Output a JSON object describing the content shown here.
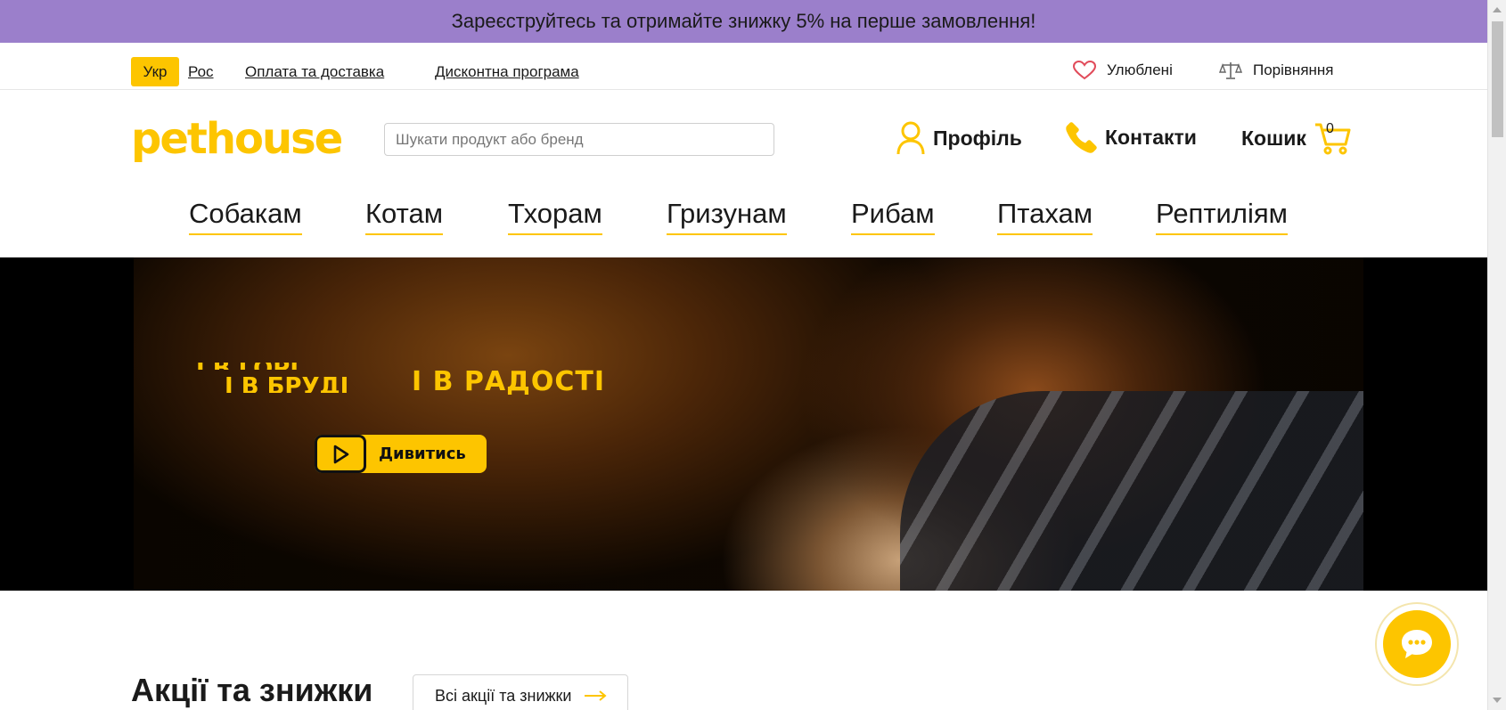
{
  "promo": {
    "text": "Зареєструйтесь та отримайте знижку 5% на перше замовлення!"
  },
  "utility": {
    "lang_active": "Укр",
    "lang_other": "Рос",
    "payment_link": "Оплата та доставка",
    "discount_link": "Дисконтна програма",
    "favorites": "Улюблені",
    "compare": "Порівняння"
  },
  "header": {
    "logo": "pethouse",
    "search_placeholder": "Шукати продукт або бренд",
    "profile": "Профіль",
    "contacts": "Контакти",
    "cart": "Кошик",
    "cart_count": "0"
  },
  "categories": [
    "Собакам",
    "Котам",
    "Тхорам",
    "Гризунам",
    "Рибам",
    "Птахам",
    "Рептиліям"
  ],
  "hero": {
    "slogan_line1": "І В ГОРІ,",
    "slogan_line2": "І В БРУДІ",
    "slogan_line3": "І В РАДОСТІ",
    "watch_button": "Дивитись"
  },
  "section": {
    "title": "Акції та знижки",
    "all_link": "Всі акції та знижки"
  },
  "colors": {
    "accent": "#fdc500",
    "promo_bg": "#9b7fcb"
  }
}
